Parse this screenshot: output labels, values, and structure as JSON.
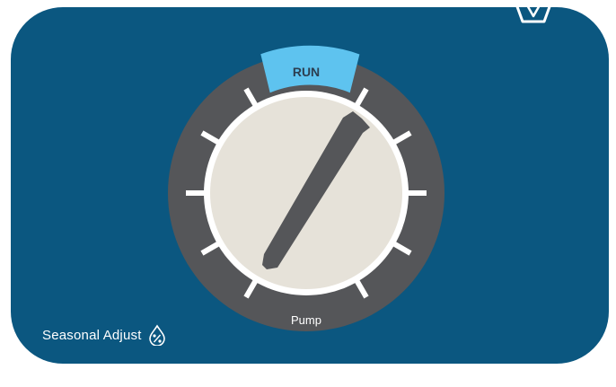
{
  "dial": {
    "selected_label": "RUN",
    "bottom_label": "Pump"
  },
  "seasonal_adjust": {
    "label": "Seasonal Adjust",
    "icon": "water-drop-percent-icon"
  },
  "brand": {
    "icon": "brand-logo-icon"
  },
  "colors": {
    "panel": "#0b5780",
    "bezel": "#555659",
    "run_segment": "#5ec3ef",
    "face": "#e6e2d9",
    "needle": "#555659",
    "tick": "#ffffff"
  }
}
